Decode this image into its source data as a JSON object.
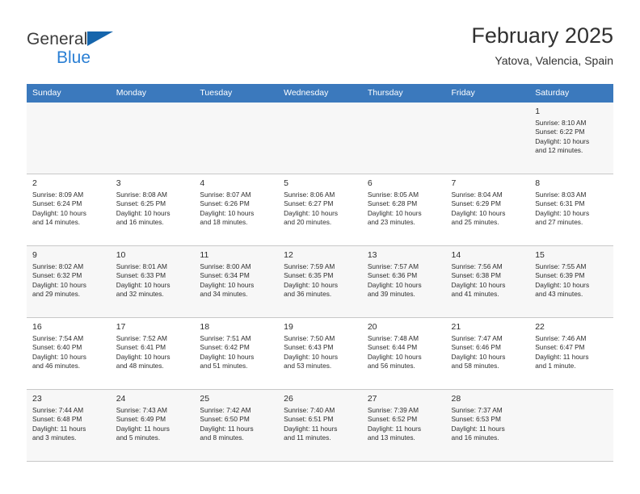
{
  "brand": {
    "name_top": "General",
    "name_bottom": "Blue",
    "flag_color": "#1565ac",
    "blue_text_color": "#2a7fd4"
  },
  "header": {
    "title": "February 2025",
    "subtitle": "Yatova, Valencia, Spain"
  },
  "theme": {
    "header_row_bg": "#3b79bd",
    "header_row_text": "#ffffff",
    "shaded_row_bg": "#f7f7f7",
    "cell_border": "#c8c8c8",
    "text": "#2d2d2d"
  },
  "weekday_headers": [
    "Sunday",
    "Monday",
    "Tuesday",
    "Wednesday",
    "Thursday",
    "Friday",
    "Saturday"
  ],
  "weeks": [
    [
      {
        "day": "",
        "detail": ""
      },
      {
        "day": "",
        "detail": ""
      },
      {
        "day": "",
        "detail": ""
      },
      {
        "day": "",
        "detail": ""
      },
      {
        "day": "",
        "detail": ""
      },
      {
        "day": "",
        "detail": ""
      },
      {
        "day": "1",
        "detail": "Sunrise: 8:10 AM\nSunset: 6:22 PM\nDaylight: 10 hours\nand 12 minutes."
      }
    ],
    [
      {
        "day": "2",
        "detail": "Sunrise: 8:09 AM\nSunset: 6:24 PM\nDaylight: 10 hours\nand 14 minutes."
      },
      {
        "day": "3",
        "detail": "Sunrise: 8:08 AM\nSunset: 6:25 PM\nDaylight: 10 hours\nand 16 minutes."
      },
      {
        "day": "4",
        "detail": "Sunrise: 8:07 AM\nSunset: 6:26 PM\nDaylight: 10 hours\nand 18 minutes."
      },
      {
        "day": "5",
        "detail": "Sunrise: 8:06 AM\nSunset: 6:27 PM\nDaylight: 10 hours\nand 20 minutes."
      },
      {
        "day": "6",
        "detail": "Sunrise: 8:05 AM\nSunset: 6:28 PM\nDaylight: 10 hours\nand 23 minutes."
      },
      {
        "day": "7",
        "detail": "Sunrise: 8:04 AM\nSunset: 6:29 PM\nDaylight: 10 hours\nand 25 minutes."
      },
      {
        "day": "8",
        "detail": "Sunrise: 8:03 AM\nSunset: 6:31 PM\nDaylight: 10 hours\nand 27 minutes."
      }
    ],
    [
      {
        "day": "9",
        "detail": "Sunrise: 8:02 AM\nSunset: 6:32 PM\nDaylight: 10 hours\nand 29 minutes."
      },
      {
        "day": "10",
        "detail": "Sunrise: 8:01 AM\nSunset: 6:33 PM\nDaylight: 10 hours\nand 32 minutes."
      },
      {
        "day": "11",
        "detail": "Sunrise: 8:00 AM\nSunset: 6:34 PM\nDaylight: 10 hours\nand 34 minutes."
      },
      {
        "day": "12",
        "detail": "Sunrise: 7:59 AM\nSunset: 6:35 PM\nDaylight: 10 hours\nand 36 minutes."
      },
      {
        "day": "13",
        "detail": "Sunrise: 7:57 AM\nSunset: 6:36 PM\nDaylight: 10 hours\nand 39 minutes."
      },
      {
        "day": "14",
        "detail": "Sunrise: 7:56 AM\nSunset: 6:38 PM\nDaylight: 10 hours\nand 41 minutes."
      },
      {
        "day": "15",
        "detail": "Sunrise: 7:55 AM\nSunset: 6:39 PM\nDaylight: 10 hours\nand 43 minutes."
      }
    ],
    [
      {
        "day": "16",
        "detail": "Sunrise: 7:54 AM\nSunset: 6:40 PM\nDaylight: 10 hours\nand 46 minutes."
      },
      {
        "day": "17",
        "detail": "Sunrise: 7:52 AM\nSunset: 6:41 PM\nDaylight: 10 hours\nand 48 minutes."
      },
      {
        "day": "18",
        "detail": "Sunrise: 7:51 AM\nSunset: 6:42 PM\nDaylight: 10 hours\nand 51 minutes."
      },
      {
        "day": "19",
        "detail": "Sunrise: 7:50 AM\nSunset: 6:43 PM\nDaylight: 10 hours\nand 53 minutes."
      },
      {
        "day": "20",
        "detail": "Sunrise: 7:48 AM\nSunset: 6:44 PM\nDaylight: 10 hours\nand 56 minutes."
      },
      {
        "day": "21",
        "detail": "Sunrise: 7:47 AM\nSunset: 6:46 PM\nDaylight: 10 hours\nand 58 minutes."
      },
      {
        "day": "22",
        "detail": "Sunrise: 7:46 AM\nSunset: 6:47 PM\nDaylight: 11 hours\nand 1 minute."
      }
    ],
    [
      {
        "day": "23",
        "detail": "Sunrise: 7:44 AM\nSunset: 6:48 PM\nDaylight: 11 hours\nand 3 minutes."
      },
      {
        "day": "24",
        "detail": "Sunrise: 7:43 AM\nSunset: 6:49 PM\nDaylight: 11 hours\nand 5 minutes."
      },
      {
        "day": "25",
        "detail": "Sunrise: 7:42 AM\nSunset: 6:50 PM\nDaylight: 11 hours\nand 8 minutes."
      },
      {
        "day": "26",
        "detail": "Sunrise: 7:40 AM\nSunset: 6:51 PM\nDaylight: 11 hours\nand 11 minutes."
      },
      {
        "day": "27",
        "detail": "Sunrise: 7:39 AM\nSunset: 6:52 PM\nDaylight: 11 hours\nand 13 minutes."
      },
      {
        "day": "28",
        "detail": "Sunrise: 7:37 AM\nSunset: 6:53 PM\nDaylight: 11 hours\nand 16 minutes."
      },
      {
        "day": "",
        "detail": ""
      }
    ]
  ]
}
